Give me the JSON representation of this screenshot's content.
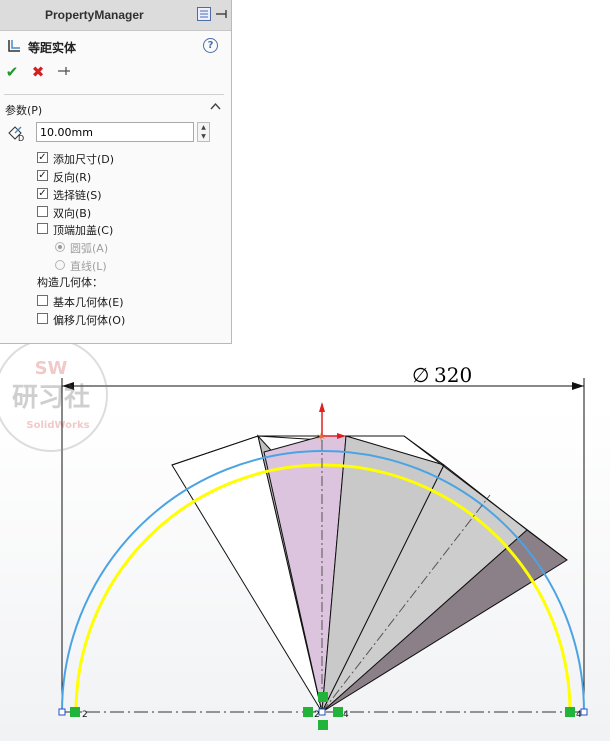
{
  "property_manager": {
    "title": "PropertyManager",
    "feature_title": "等距实体",
    "help_label": "?",
    "group_title": "参数(P)",
    "distance": {
      "value": "10.00mm"
    },
    "options": [
      {
        "label": "添加尺寸(D)",
        "checked": true
      },
      {
        "label": "反向(R)",
        "checked": true
      },
      {
        "label": "选择链(S)",
        "checked": true
      },
      {
        "label": "双向(B)",
        "checked": false
      },
      {
        "label": "顶端加盖(C)",
        "checked": false
      }
    ],
    "cap_options": [
      {
        "label": "圆弧(A)",
        "selected": true
      },
      {
        "label": "直线(L)",
        "selected": false
      }
    ],
    "construction_title": "构造几何体：",
    "construction_options": [
      {
        "label": "基本几何体(E)",
        "checked": false
      },
      {
        "label": "偏移几何体(O)",
        "checked": false
      }
    ]
  },
  "watermark": {
    "line1": "SW",
    "line2": "研习社",
    "line3": "SolidWorks"
  },
  "drawing": {
    "dimension_text": "320",
    "dimension_symbol": "∅",
    "point_labels": [
      "2",
      "2",
      "4",
      "4"
    ],
    "colors": {
      "blue_arc": "#4ba3e3",
      "yellow_arc": "#ffff00",
      "pink_face": "#dcc4de",
      "gray_face": "#c8c8c8",
      "dark_face": "#8a7c86",
      "point_green": "#21b33a",
      "origin_red": "#e02020"
    }
  }
}
